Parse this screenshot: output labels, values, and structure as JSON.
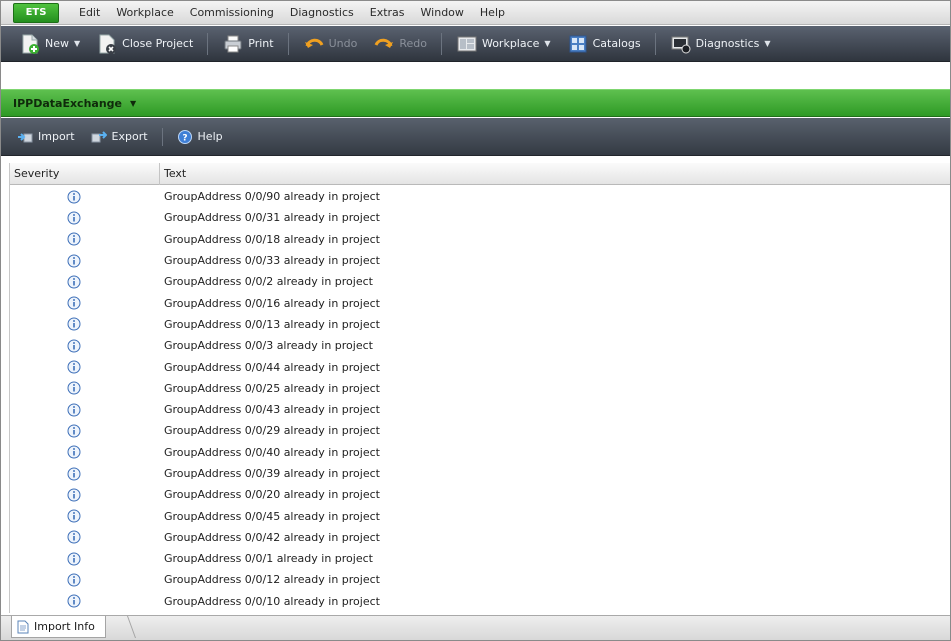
{
  "menu": {
    "app_button": "ETS",
    "items": [
      "Edit",
      "Workplace",
      "Commissioning",
      "Diagnostics",
      "Extras",
      "Window",
      "Help"
    ]
  },
  "toolbar": {
    "new": "New",
    "close_project": "Close Project",
    "print": "Print",
    "undo": "Undo",
    "redo": "Redo",
    "workplace": "Workplace",
    "catalogs": "Catalogs",
    "diagnostics": "Diagnostics"
  },
  "module": {
    "title": "IPPDataExchange"
  },
  "subtoolbar": {
    "import": "Import",
    "export": "Export",
    "help": "Help"
  },
  "grid": {
    "columns": [
      "Severity",
      "Text"
    ],
    "rows": [
      "GroupAddress 0/0/90 already in project",
      "GroupAddress 0/0/31 already in project",
      "GroupAddress 0/0/18 already in project",
      "GroupAddress 0/0/33 already in project",
      "GroupAddress 0/0/2 already in project",
      "GroupAddress 0/0/16 already in project",
      "GroupAddress 0/0/13 already in project",
      "GroupAddress 0/0/3 already in project",
      "GroupAddress 0/0/44 already in project",
      "GroupAddress 0/0/25 already in project",
      "GroupAddress 0/0/43 already in project",
      "GroupAddress 0/0/29 already in project",
      "GroupAddress 0/0/40 already in project",
      "GroupAddress 0/0/39 already in project",
      "GroupAddress 0/0/20 already in project",
      "GroupAddress 0/0/45 already in project",
      "GroupAddress 0/0/42 already in project",
      "GroupAddress 0/0/1 already in project",
      "GroupAddress 0/0/12 already in project",
      "GroupAddress 0/0/10 already in project"
    ],
    "severity_icon": "info-icon"
  },
  "tabs": {
    "active": "Import Info"
  },
  "colors": {
    "accent_green": "#3aa82e",
    "toolbar_dark": "#3a4048",
    "info_blue": "#3d6fb8"
  }
}
